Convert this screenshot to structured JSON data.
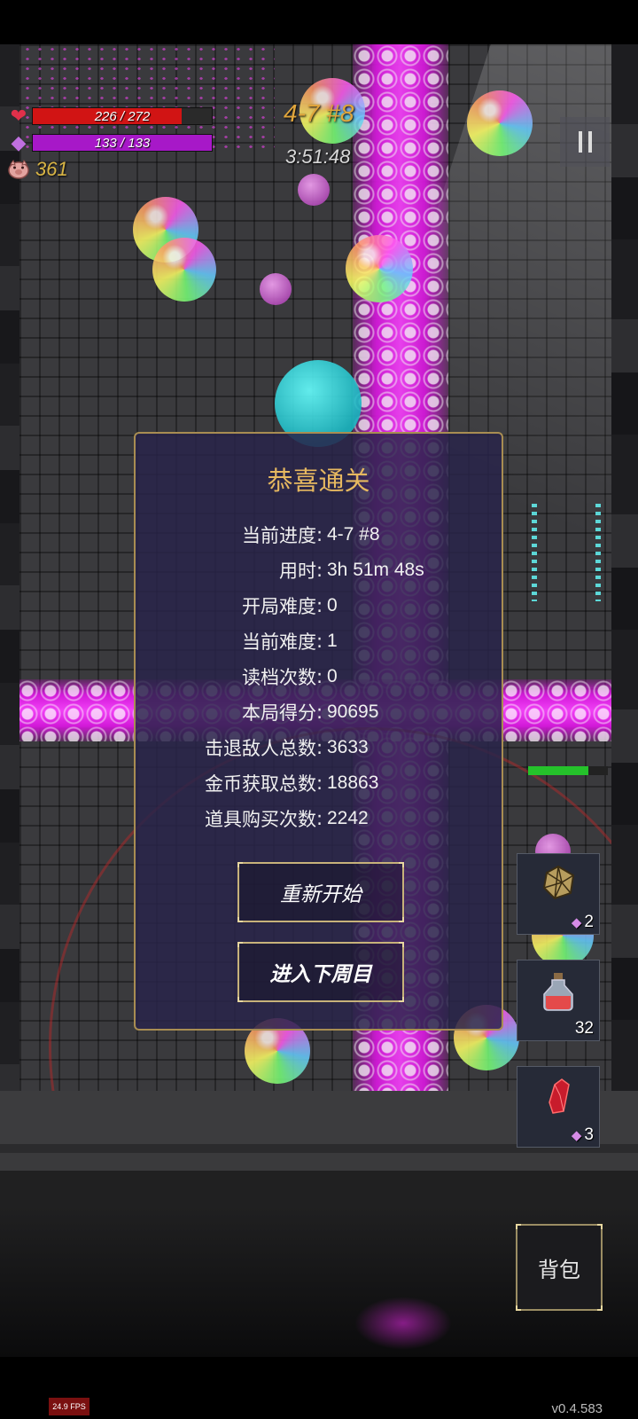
{
  "hud": {
    "hp_text": "226 / 272",
    "hp_fraction": 0.83,
    "hp_color": "#d11414",
    "mana_text": "133 / 133",
    "mana_fraction": 1.0,
    "mana_color": "#a718c8",
    "coins": "361",
    "stage": "4-7 #8",
    "timer": "3:51:48",
    "heart_icon": "heart-icon",
    "mana_icon": "diamond-gem-icon",
    "coin_icon": "pig-coin-icon",
    "pause_icon": "pause-icon"
  },
  "modal": {
    "title": "恭喜通关",
    "stats": [
      {
        "label": "当前进度",
        "value": "4-7 #8"
      },
      {
        "label": "用时",
        "value": "3h 51m 48s"
      },
      {
        "label": "开局难度",
        "value": "0"
      },
      {
        "label": "当前难度",
        "value": "1"
      },
      {
        "label": "读档次数",
        "value": "0"
      },
      {
        "label": "本局得分",
        "value": "90695"
      },
      {
        "label": "击退敌人总数",
        "value": "3633"
      },
      {
        "label": "金币获取总数",
        "value": "18863"
      },
      {
        "label": "道具购买次数",
        "value": "2242"
      }
    ],
    "colon": ":",
    "restart_label": "重新开始",
    "next_cycle_label": "进入下周目"
  },
  "items": [
    {
      "icon": "polyhedron-die-icon",
      "count": "2",
      "gem": true
    },
    {
      "icon": "potion-flask-icon",
      "count": "32",
      "gem": false
    },
    {
      "icon": "red-crystal-icon",
      "count": "3",
      "gem": true
    }
  ],
  "bag_label": "背包",
  "fps": "24.9 FPS",
  "version": "v0.4.583",
  "colors": {
    "modal_bg": "#28244a",
    "modal_border": "#a88d52",
    "title_gold": "#e6b860",
    "stage_orange": "#e0a53c",
    "laser_magenta": "#f040f5"
  }
}
